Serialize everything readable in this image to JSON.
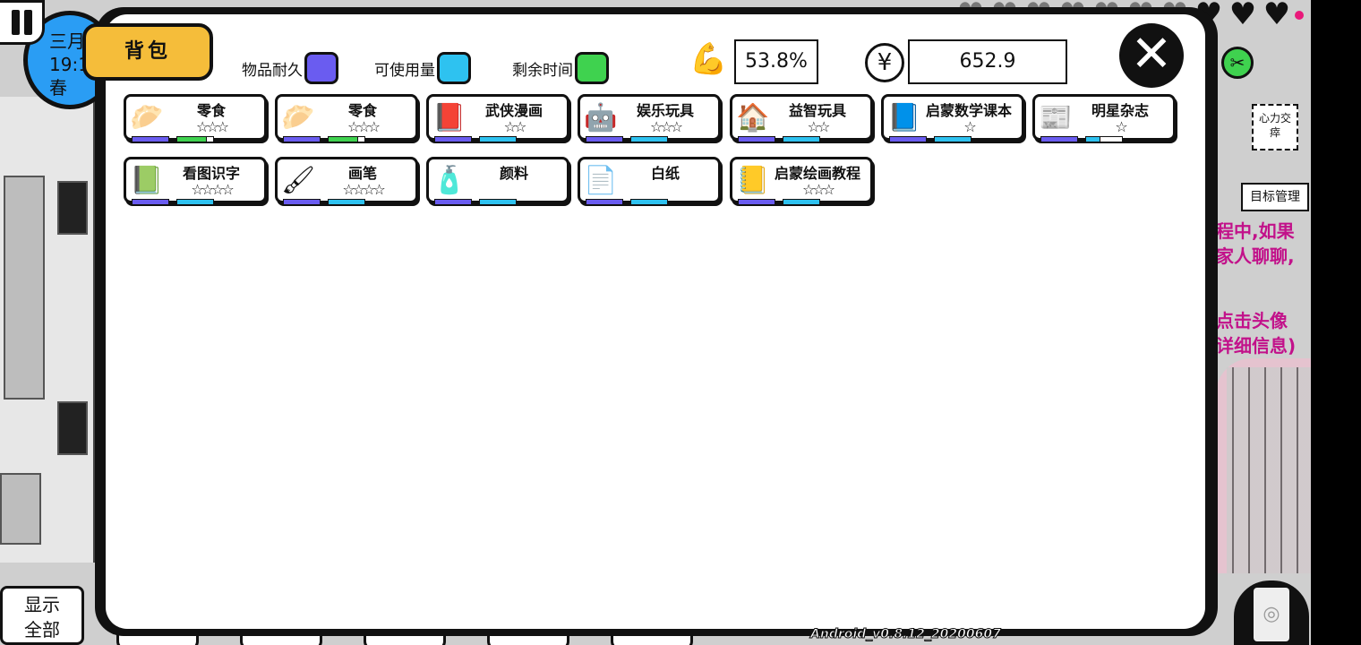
{
  "scene": {
    "clock": {
      "month": "三月",
      "time": "19:1",
      "season": "春"
    },
    "hearts_total": 10,
    "hearts_ghost": 7,
    "side_buttons": {
      "heart_exchange": "心力交\n瘁",
      "goal_manage": "目标管理"
    },
    "story_lines": [
      "程中,如果",
      "家人聊聊,",
      "",
      "",
      "点击头像",
      "详细信息)"
    ],
    "show_all": "显示\n全部",
    "version": "Android_v0.8.12_20200607"
  },
  "bag": {
    "title": "背包",
    "legend": [
      {
        "label": "物品耐久",
        "color": "#6a5cf0"
      },
      {
        "label": "可使用量",
        "color": "#2ec2f0"
      },
      {
        "label": "剩余时间",
        "color": "#3fd24f"
      }
    ],
    "strength_value": "53.8%",
    "money_icon": "¥",
    "money_value": "652.9",
    "close_icon": "close-icon"
  },
  "items": [
    {
      "name": "零食",
      "icon": "snack-bag-icon",
      "glyph": "🥟",
      "stars": 3,
      "bars": [
        {
          "type": "dur",
          "fill": 1.0
        },
        {
          "type": "time",
          "fill": 0.8
        }
      ]
    },
    {
      "name": "零食",
      "icon": "snack-bag-icon",
      "glyph": "🥟",
      "stars": 3,
      "bars": [
        {
          "type": "dur",
          "fill": 1.0
        },
        {
          "type": "time",
          "fill": 0.8
        }
      ]
    },
    {
      "name": "武侠漫画",
      "icon": "comic-book-icon",
      "glyph": "📕",
      "stars": 2,
      "bars": [
        {
          "type": "dur",
          "fill": 1.0
        },
        {
          "type": "use",
          "fill": 1.0
        }
      ]
    },
    {
      "name": "娱乐玩具",
      "icon": "robot-toy-icon",
      "glyph": "🤖",
      "stars": 3,
      "bars": [
        {
          "type": "dur",
          "fill": 1.0
        },
        {
          "type": "use",
          "fill": 1.0
        }
      ]
    },
    {
      "name": "益智玩具",
      "icon": "puzzle-house-icon",
      "glyph": "🏠",
      "stars": 2,
      "bars": [
        {
          "type": "dur",
          "fill": 1.0
        },
        {
          "type": "use",
          "fill": 1.0
        }
      ]
    },
    {
      "name": "启蒙数学课本",
      "icon": "math-book-icon",
      "glyph": "📘",
      "stars": 1,
      "bars": [
        {
          "type": "dur",
          "fill": 1.0
        },
        {
          "type": "use",
          "fill": 1.0
        }
      ]
    },
    {
      "name": "明星杂志",
      "icon": "magazine-icon",
      "glyph": "📰",
      "stars": 1,
      "bars": [
        {
          "type": "dur",
          "fill": 1.0
        },
        {
          "type": "use",
          "fill": 0.4
        }
      ]
    },
    {
      "name": "看图识字",
      "icon": "picture-book-icon",
      "glyph": "📗",
      "stars": 4,
      "bars": [
        {
          "type": "dur",
          "fill": 1.0
        },
        {
          "type": "use",
          "fill": 1.0
        }
      ]
    },
    {
      "name": "画笔",
      "icon": "paintbrush-icon",
      "glyph": "🖌",
      "stars": 4,
      "bars": [
        {
          "type": "dur",
          "fill": 1.0
        },
        {
          "type": "use",
          "fill": 1.0
        }
      ]
    },
    {
      "name": "颜料",
      "icon": "paint-tube-icon",
      "glyph": "🧴",
      "stars": 0,
      "bars": [
        {
          "type": "dur",
          "fill": 1.0
        },
        {
          "type": "use",
          "fill": 1.0
        }
      ]
    },
    {
      "name": "白纸",
      "icon": "paper-sheet-icon",
      "glyph": "📄",
      "stars": 0,
      "bars": [
        {
          "type": "dur",
          "fill": 1.0
        },
        {
          "type": "use",
          "fill": 1.0
        }
      ]
    },
    {
      "name": "启蒙绘画教程",
      "icon": "drawing-book-icon",
      "glyph": "📒",
      "stars": 3,
      "bars": [
        {
          "type": "dur",
          "fill": 1.0
        },
        {
          "type": "use",
          "fill": 1.0
        }
      ]
    }
  ]
}
